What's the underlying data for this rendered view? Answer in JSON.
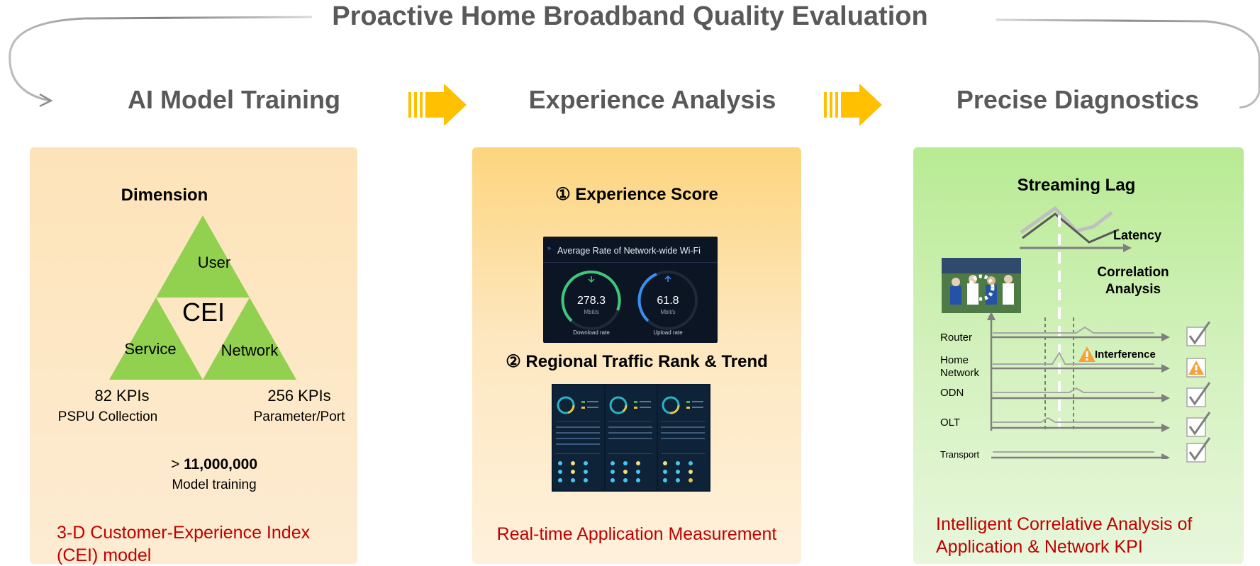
{
  "title": "Proactive Home Broadband Quality Evaluation",
  "stages": [
    "AI Model Training",
    "Experience Analysis",
    "Precise Diagnostics"
  ],
  "panel1": {
    "heading": "Dimension",
    "triangle": {
      "top": "User",
      "center": "CEI",
      "left": "Service",
      "right": "Network"
    },
    "kpi_left_value": "82 KPIs",
    "kpi_left_label": "PSPU Collection",
    "kpi_right_value": "256 KPIs",
    "kpi_right_label": "Parameter/Port",
    "training_prefix": ">",
    "training_value": "11,000,000",
    "training_label": "Model training",
    "caption_line1": "3-D Customer-Experience Index",
    "caption_line2": "(CEI) model"
  },
  "panel2": {
    "heading1": "① Experience Score",
    "wifi_title": "Average Rate of Network-wide Wi-Fi",
    "download_value": "278.3",
    "download_unit": "Mbit/s",
    "download_label": "Download rate",
    "upload_value": "61.8",
    "upload_unit": "Mbit/s",
    "upload_label": "Upload rate",
    "heading2": "② Regional Traffic Rank & Trend",
    "caption": "Real-time Application Measurement"
  },
  "panel3": {
    "heading": "Streaming Lag",
    "latency_label": "Latency",
    "correlation_line1": "Correlation",
    "correlation_line2": "Analysis",
    "rows": [
      "Router",
      "Home Network",
      "ODN",
      "OLT",
      "Transport"
    ],
    "home_line1": "Home",
    "home_line2": "Network",
    "interference_label": "Interference",
    "caption_line1": "Intelligent Correlative Analysis of",
    "caption_line2": "Application & Network KPI"
  },
  "colors": {
    "stage_text": "#595959",
    "triangle_green": "#92d050",
    "arrow_orange": "#ffc000",
    "caption_red": "#c00000",
    "ok_check": "#7f7f7f",
    "warning_orange": "#f4a33a"
  }
}
